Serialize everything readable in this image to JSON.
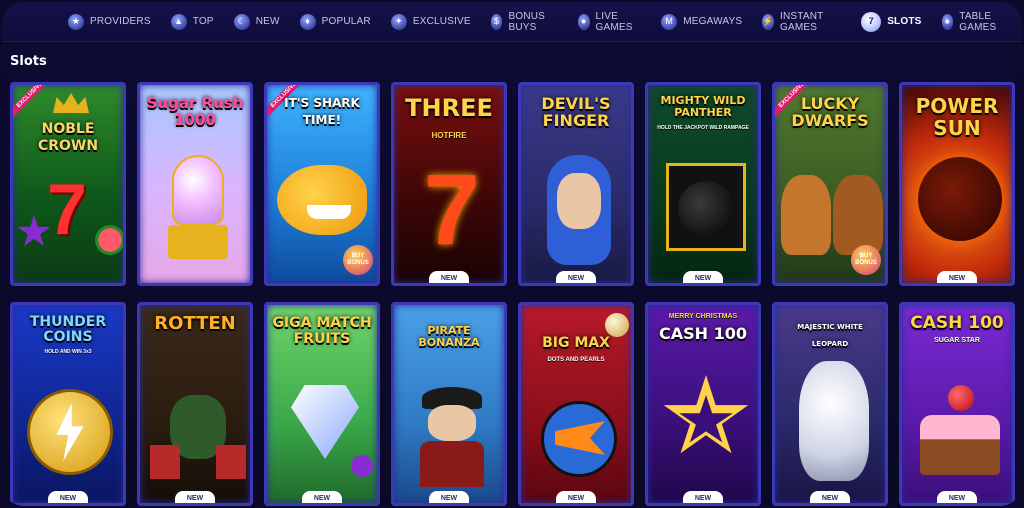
{
  "nav": {
    "items": [
      {
        "label": "PROVIDERS",
        "icon": "providers-icon"
      },
      {
        "label": "TOP",
        "icon": "top-icon"
      },
      {
        "label": "NEW",
        "icon": "new-icon"
      },
      {
        "label": "POPULAR",
        "icon": "popular-icon"
      },
      {
        "label": "EXCLUSIVE",
        "icon": "exclusive-icon"
      },
      {
        "label": "BONUS BUYS",
        "icon": "bonus-buys-icon"
      },
      {
        "label": "LIVE GAMES",
        "icon": "live-games-icon"
      },
      {
        "label": "MEGAWAYS",
        "icon": "megaways-icon"
      },
      {
        "label": "INSTANT GAMES",
        "icon": "instant-games-icon"
      },
      {
        "label": "SLOTS",
        "icon": "slots-icon",
        "active": true
      },
      {
        "label": "TABLE GAMES",
        "icon": "table-games-icon"
      }
    ]
  },
  "section": {
    "title": "Slots"
  },
  "games": [
    {
      "title": "NOBLE CROWN",
      "sub": "",
      "exclusive": "EXCLUSIVE",
      "new": ""
    },
    {
      "title": "Sugar Rush 1000",
      "sub": "",
      "exclusive": "",
      "new": ""
    },
    {
      "title": "IT'S SHARK TIME!",
      "sub": "",
      "exclusive": "EXCLUSIVE",
      "new": "",
      "bonus": "BUY BONUS"
    },
    {
      "title": "THREE",
      "sub": "HOTFIRE",
      "exclusive": "",
      "new": "NEW"
    },
    {
      "title": "DEVIL'S FINGER",
      "sub": "",
      "exclusive": "",
      "new": "NEW"
    },
    {
      "title": "MIGHTY WILD PANTHER",
      "sub": "HOLD THE JACKPOT WILD RAMPAGE",
      "exclusive": "",
      "new": "NEW"
    },
    {
      "title": "LUCKY DWARFS",
      "sub": "",
      "exclusive": "EXCLUSIVE",
      "new": "",
      "bonus": "BUY BONUS"
    },
    {
      "title": "POWER SUN",
      "sub": "",
      "exclusive": "",
      "new": "NEW"
    },
    {
      "title": "THUNDER COINS",
      "sub": "HOLD AND WIN 3x3",
      "exclusive": "",
      "new": "NEW"
    },
    {
      "title": "ROTTEN",
      "sub": "",
      "exclusive": "",
      "new": "NEW"
    },
    {
      "title": "GIGA MATCH FRUITS",
      "sub": "",
      "exclusive": "",
      "new": "NEW"
    },
    {
      "title": "PIRATE BONANZA",
      "sub": "",
      "exclusive": "",
      "new": "NEW"
    },
    {
      "title": "BIG MAX",
      "sub": "DOTS AND PEARLS",
      "exclusive": "",
      "new": "NEW"
    },
    {
      "title": "CASH 100",
      "sub": "MERRY CHRISTMAS",
      "exclusive": "",
      "new": "NEW"
    },
    {
      "title": "MAJESTIC WHITE LEOPARD",
      "sub": "",
      "exclusive": "",
      "new": "NEW"
    },
    {
      "title": "CASH 100",
      "sub": "SUGAR STAR",
      "exclusive": "",
      "new": "NEW"
    }
  ],
  "colors": {
    "background": "#0b0a2a",
    "card_border": "#3c39b8",
    "accent": "#e01a6e"
  }
}
